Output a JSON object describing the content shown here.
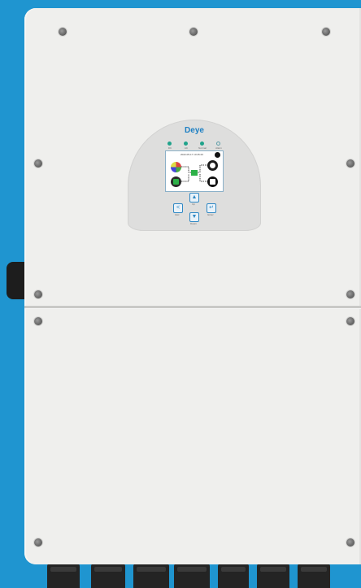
{
  "device": {
    "brand": "Deye",
    "status_leds": [
      {
        "label": "DC",
        "on": true
      },
      {
        "label": "AC",
        "on": true
      },
      {
        "label": "Normal",
        "on": true
      },
      {
        "label": "Alarm",
        "on": false
      }
    ],
    "display": {
      "header": "2022-05-17   10:45:20"
    },
    "buttons": [
      {
        "label": "Up"
      },
      {
        "label": "Esc"
      },
      {
        "label": "Enter"
      },
      {
        "label": "Down"
      }
    ],
    "colors": {
      "background": "#1f95d0",
      "enclosure": "#efefed",
      "accent": "#1c7fc3",
      "led_on": "#20a38b"
    }
  }
}
